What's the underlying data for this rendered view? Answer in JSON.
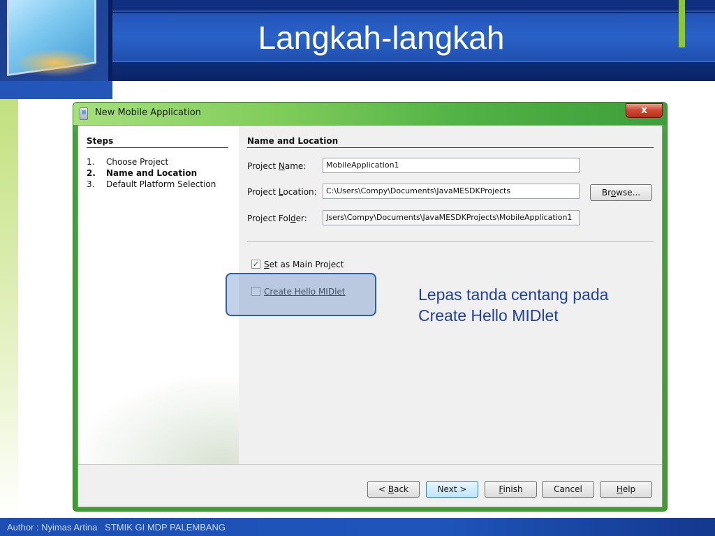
{
  "slide": {
    "title": "Langkah-langkah",
    "footer": "Author : Nyimas Artina   STMIK GI MDP PALEMBANG",
    "accent_color": "#8cc63f",
    "header_color": "#2a62c8"
  },
  "dialog": {
    "window_title": "New Mobile Application",
    "close_label": "x",
    "steps": {
      "heading": "Steps",
      "items": [
        {
          "number": "1.",
          "label": "Choose Project",
          "current": false
        },
        {
          "number": "2.",
          "label": "Name and Location",
          "current": true
        },
        {
          "number": "3.",
          "label": "Default Platform Selection",
          "current": false
        }
      ]
    },
    "section_heading": "Name and Location",
    "fields": {
      "project_name": {
        "label_pre": "Project ",
        "label_key": "N",
        "label_post": "ame:",
        "value": "MobileApplication1"
      },
      "project_location": {
        "label_pre": "Project ",
        "label_key": "L",
        "label_post": "ocation:",
        "value": "C:\\Users\\Compy\\Documents\\JavaMESDKProjects"
      },
      "project_folder": {
        "label_pre": "Project Fol",
        "label_key": "d",
        "label_post": "er:",
        "value": "Jsers\\Compy\\Documents\\JavaMESDKProjects\\MobileApplication1"
      }
    },
    "browse": {
      "pre": "Br",
      "key": "o",
      "post": "wse..."
    },
    "checkboxes": {
      "main_project": {
        "key": "S",
        "post": "et as Main Project",
        "checked": true,
        "check_glyph": "✓"
      },
      "hello_midlet": {
        "pre": "",
        "key": "C",
        "mid": "reate Hello ",
        "key2": "M",
        "post": "IDlet",
        "checked": false
      }
    },
    "buttons": {
      "back": {
        "pre": "< ",
        "key": "B",
        "post": "ack"
      },
      "next": {
        "label": "Next >"
      },
      "finish": {
        "key": "F",
        "post": "inish"
      },
      "cancel": {
        "label": "Cancel"
      },
      "help": {
        "key": "H",
        "post": "elp"
      }
    }
  },
  "annotation": {
    "callout_line1": "Lepas tanda centang pada",
    "callout_line2": "Create Hello MIDlet",
    "highlight_color": "#2f5fa8"
  }
}
